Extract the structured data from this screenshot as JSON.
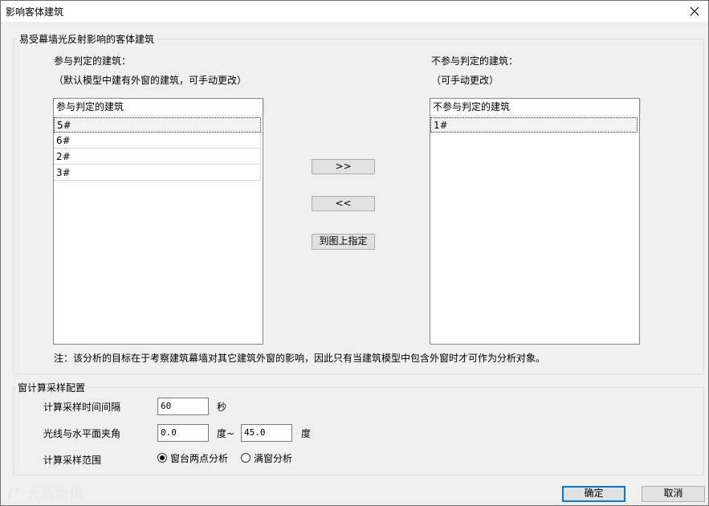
{
  "window": {
    "title": "影响客体建筑"
  },
  "group1": {
    "legend": "易受幕墙光反射影响的客体建筑",
    "left_label": "参与判定的建筑：",
    "left_sublabel": "（默认模型中建有外窗的建筑，可手动更改）",
    "right_label": "不参与判定的建筑：",
    "right_sublabel": "（可手动更改）",
    "left_list": {
      "header": "参与判定的建筑",
      "items": [
        "5#",
        "6#",
        "2#",
        "3#"
      ]
    },
    "right_list": {
      "header": "不参与判定的建筑",
      "items": [
        "1#"
      ]
    },
    "btn_move_right": ">>",
    "btn_move_left": "<<",
    "btn_pick": "到图上指定",
    "note": "注：该分析的目标在于考察建筑幕墙对其它建筑外窗的影响，因此只有当建筑模型中包含外窗时才可作为分析对象。"
  },
  "group2": {
    "legend": "窗计算采样配置",
    "interval_label": "计算采样时间间隔",
    "interval_value": "60",
    "interval_unit": "秒",
    "angle_label": "光线与水平面夹角",
    "angle_min": "0.0",
    "angle_mid_unit": "度~",
    "angle_max": "45.0",
    "angle_unit": "度",
    "range_label": "计算采样范围",
    "range_option1": "窗台两点分析",
    "range_option2": "满窗分析"
  },
  "footer": {
    "ok": "确定",
    "cancel": "取消"
  },
  "watermark": "大数跨境"
}
